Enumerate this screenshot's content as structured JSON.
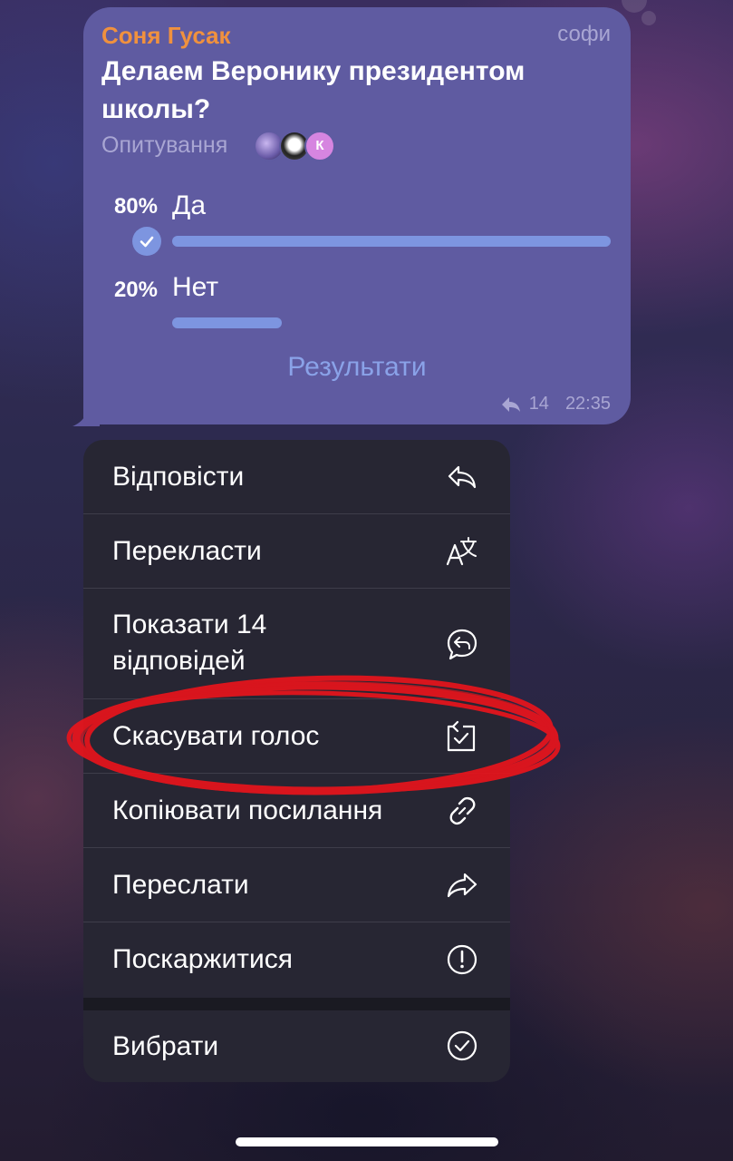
{
  "poll": {
    "sender": "Соня Гусак",
    "author": "софи",
    "question": "Делаем Веронику президентом школы?",
    "type_label": "Опитування",
    "voter_badge": "К",
    "options": [
      {
        "percent": "80%",
        "label": "Да",
        "share": 0.8,
        "selected": true
      },
      {
        "percent": "20%",
        "label": "Нет",
        "share": 0.2,
        "selected": false
      }
    ],
    "results_label": "Результати",
    "replies_count": "14",
    "time": "22:35"
  },
  "menu": {
    "items": [
      {
        "label": "Відповісти",
        "icon": "reply-icon"
      },
      {
        "label": "Перекласти",
        "icon": "translate-icon"
      },
      {
        "label": "Показати 14 відповідей",
        "icon": "replies-icon"
      },
      {
        "label": "Скасувати голос",
        "icon": "retract-vote-icon"
      },
      {
        "label": "Копіювати посилання",
        "icon": "link-icon"
      },
      {
        "label": "Переслати",
        "icon": "forward-icon"
      },
      {
        "label": "Поскаржитися",
        "icon": "report-icon"
      },
      {
        "label": "Вибрати",
        "icon": "select-icon"
      }
    ]
  },
  "colors": {
    "bubble": "#5f5ba1",
    "sender": "#f0913e",
    "bar": "#7d95e0",
    "menu": "#272633",
    "annotation": "#e8141c"
  }
}
